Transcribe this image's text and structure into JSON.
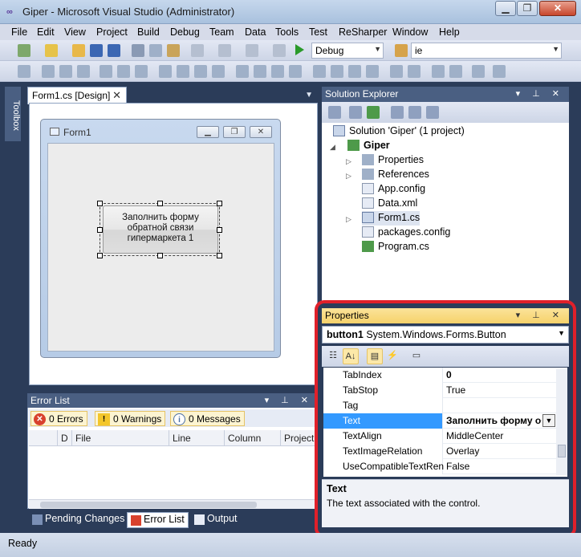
{
  "window": {
    "title": "Giper - Microsoft Visual Studio (Administrator)",
    "minimize": "▁",
    "maximize": "❐",
    "close": "✕"
  },
  "menu": [
    "File",
    "Edit",
    "View",
    "Project",
    "Build",
    "Debug",
    "Team",
    "Data",
    "Tools",
    "Test",
    "ReSharper",
    "Window",
    "Help"
  ],
  "toolbar": {
    "config_value": "Debug",
    "find_value": "ie"
  },
  "toolbox": {
    "label": "Toolbox"
  },
  "document": {
    "tab_label": "Form1.cs [Design]"
  },
  "form1": {
    "title": "Form1",
    "button_text": "Заполнить форму обратной связи гипермаркета 1"
  },
  "error_list": {
    "title": "Error List",
    "errors": "0 Errors",
    "warnings": "0 Warnings",
    "messages": "0 Messages",
    "columns": [
      "",
      "D",
      "File",
      "Line",
      "Column",
      "Project"
    ]
  },
  "bottom_tabs": [
    "Pending Changes",
    "Error List",
    "Output"
  ],
  "solution_explorer": {
    "title": "Solution Explorer",
    "items": [
      {
        "label": "Solution 'Giper' (1 project)"
      },
      {
        "label": "Giper"
      },
      {
        "label": "Properties"
      },
      {
        "label": "References"
      },
      {
        "label": "App.config"
      },
      {
        "label": "Data.xml"
      },
      {
        "label": "Form1.cs"
      },
      {
        "label": "packages.config"
      },
      {
        "label": "Program.cs"
      }
    ]
  },
  "properties": {
    "title": "Properties",
    "object_name": "button1",
    "object_type": "System.Windows.Forms.Button",
    "rows": [
      {
        "name": "TabIndex",
        "value": "0"
      },
      {
        "name": "TabStop",
        "value": "True"
      },
      {
        "name": "Tag",
        "value": ""
      },
      {
        "name": "Text",
        "value": "Заполнить форму об"
      },
      {
        "name": "TextAlign",
        "value": "MiddleCenter"
      },
      {
        "name": "TextImageRelation",
        "value": "Overlay"
      },
      {
        "name": "UseCompatibleTextRen",
        "value": "False"
      }
    ],
    "desc_title": "Text",
    "desc_text": "The text associated with the control."
  },
  "status": {
    "text": "Ready"
  },
  "colors": {
    "highlight_frame": "#e0202a",
    "selected_row": "#3399ff",
    "panel_header": "#4a5f82",
    "active_header": "#f6d26a"
  }
}
